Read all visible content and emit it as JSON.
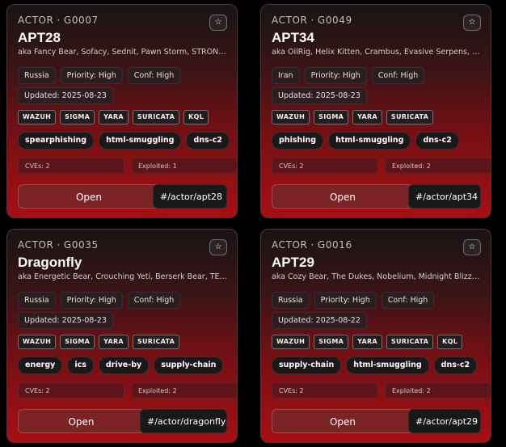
{
  "cards": [
    {
      "kind": "ACTOR",
      "id": "G0007",
      "name": "APT28",
      "aka": "aka Fancy Bear, Sofacy, Sednit, Pawn Storm, STRONTIUM",
      "country": "Russia",
      "priority": "Priority: High",
      "confidence": "Conf: High",
      "updated": "Updated: 2025-08-23",
      "rules": [
        "WAZUH",
        "SIGMA",
        "YARA",
        "SURICATA",
        "KQL"
      ],
      "tags": [
        "spearphishing",
        "html-smuggling",
        "dns-c2"
      ],
      "cves": "CVEs: 2",
      "exploited": "Exploited: 1",
      "open_label": "Open",
      "link": "#/actor/apt28"
    },
    {
      "kind": "ACTOR",
      "id": "G0049",
      "name": "APT34",
      "aka": "aka OilRig, Helix Kitten, Crambus, Evasive Serpens, Haz...",
      "country": "Iran",
      "priority": "Priority: High",
      "confidence": "Conf: High",
      "updated": "Updated: 2025-08-23",
      "rules": [
        "WAZUH",
        "SIGMA",
        "YARA",
        "SURICATA"
      ],
      "tags": [
        "phishing",
        "html-smuggling",
        "dns-c2"
      ],
      "cves": "CVEs: 2",
      "exploited": "Exploited: 2",
      "open_label": "Open",
      "link": "#/actor/apt34"
    },
    {
      "kind": "ACTOR",
      "id": "G0035",
      "name": "Dragonfly",
      "aka": "aka Energetic Bear, Crouching Yeti, Berserk Bear, TEMP....",
      "country": "Russia",
      "priority": "Priority: High",
      "confidence": "Conf: High",
      "updated": "Updated: 2025-08-23",
      "rules": [
        "WAZUH",
        "SIGMA",
        "YARA",
        "SURICATA"
      ],
      "tags": [
        "energy",
        "ics",
        "drive-by",
        "supply-chain"
      ],
      "cves": "CVEs: 2",
      "exploited": "Exploited: 2",
      "open_label": "Open",
      "link": "#/actor/dragonfly"
    },
    {
      "kind": "ACTOR",
      "id": "G0016",
      "name": "APT29",
      "aka": "aka Cozy Bear, The Dukes, Nobelium, Midnight Blizzard",
      "country": "Russia",
      "priority": "Priority: High",
      "confidence": "Conf: High",
      "updated": "Updated: 2025-08-22",
      "rules": [
        "WAZUH",
        "SIGMA",
        "YARA",
        "SURICATA",
        "KQL"
      ],
      "tags": [
        "supply-chain",
        "html-smuggling",
        "dns-c2"
      ],
      "cves": "CVEs: 2",
      "exploited": "Exploited: 2",
      "open_label": "Open",
      "link": "#/actor/apt29"
    }
  ],
  "star_glyph": "☆"
}
